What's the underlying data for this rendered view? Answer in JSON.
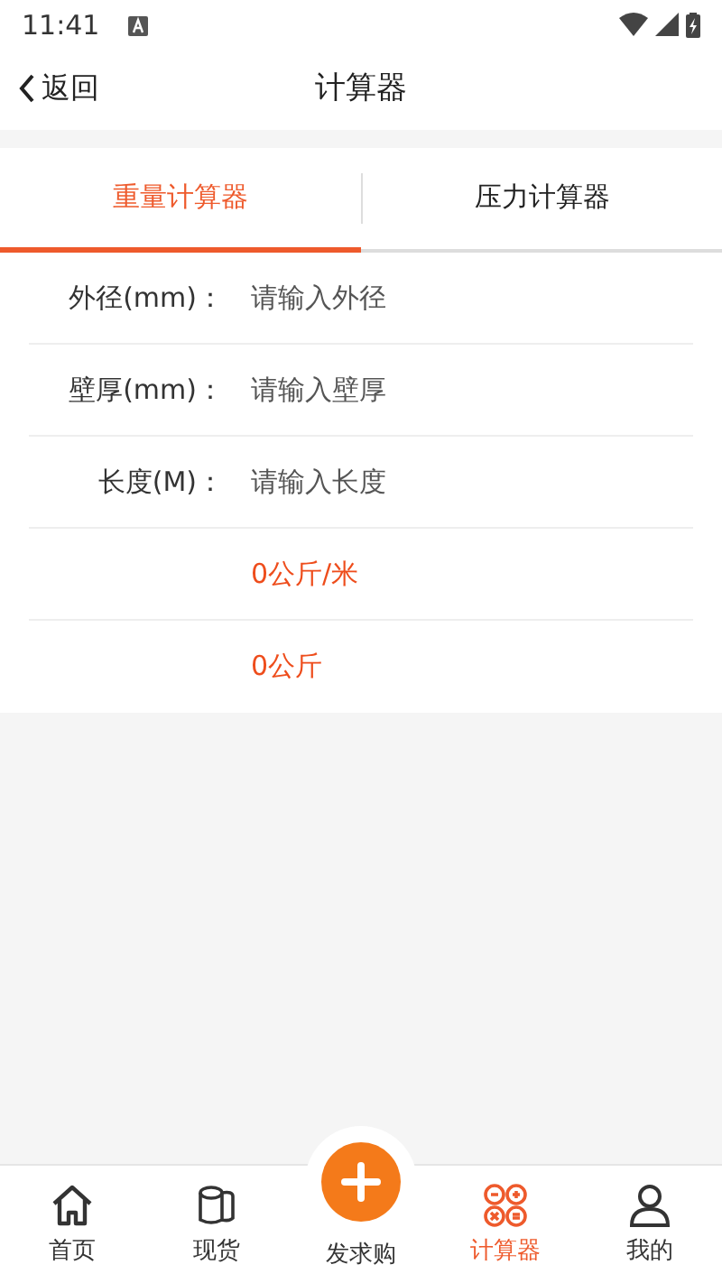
{
  "status_bar": {
    "time": "11:41"
  },
  "header": {
    "back": "返回",
    "title": "计算器"
  },
  "tabs": [
    {
      "label": "重量计算器",
      "selected": true
    },
    {
      "label": "压力计算器",
      "selected": false
    }
  ],
  "fields": [
    {
      "label": "外径(mm)：",
      "placeholder": "请输入外径"
    },
    {
      "label": "壁厚(mm)：",
      "placeholder": "请输入壁厚"
    },
    {
      "label": "长度(M)：",
      "placeholder": "请输入长度"
    }
  ],
  "results": [
    "0公斤/米",
    "0公斤"
  ],
  "nav": [
    {
      "kind": "home",
      "label": "首页",
      "selected": false
    },
    {
      "kind": "stock",
      "label": "现货",
      "selected": false
    },
    {
      "kind": "post",
      "label": "发求购",
      "selected": false
    },
    {
      "kind": "calc",
      "label": "计算器",
      "selected": true
    },
    {
      "kind": "user",
      "label": "我的",
      "selected": false
    }
  ]
}
